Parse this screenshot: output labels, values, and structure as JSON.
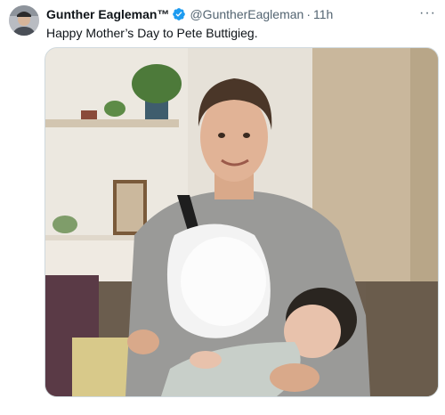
{
  "tweet": {
    "display_name": "Gunther Eagleman™",
    "handle": "@GuntherEagleman",
    "separator": "·",
    "time": "11h",
    "text": "Happy Mother’s Day to Pete Buttigieg.",
    "more": "···"
  },
  "icons": {
    "verified": "verified-badge-icon",
    "more": "more-options-icon"
  },
  "colors": {
    "verified": "#1d9bf0",
    "secondary_text": "#536471",
    "primary_text": "#0f1419"
  }
}
